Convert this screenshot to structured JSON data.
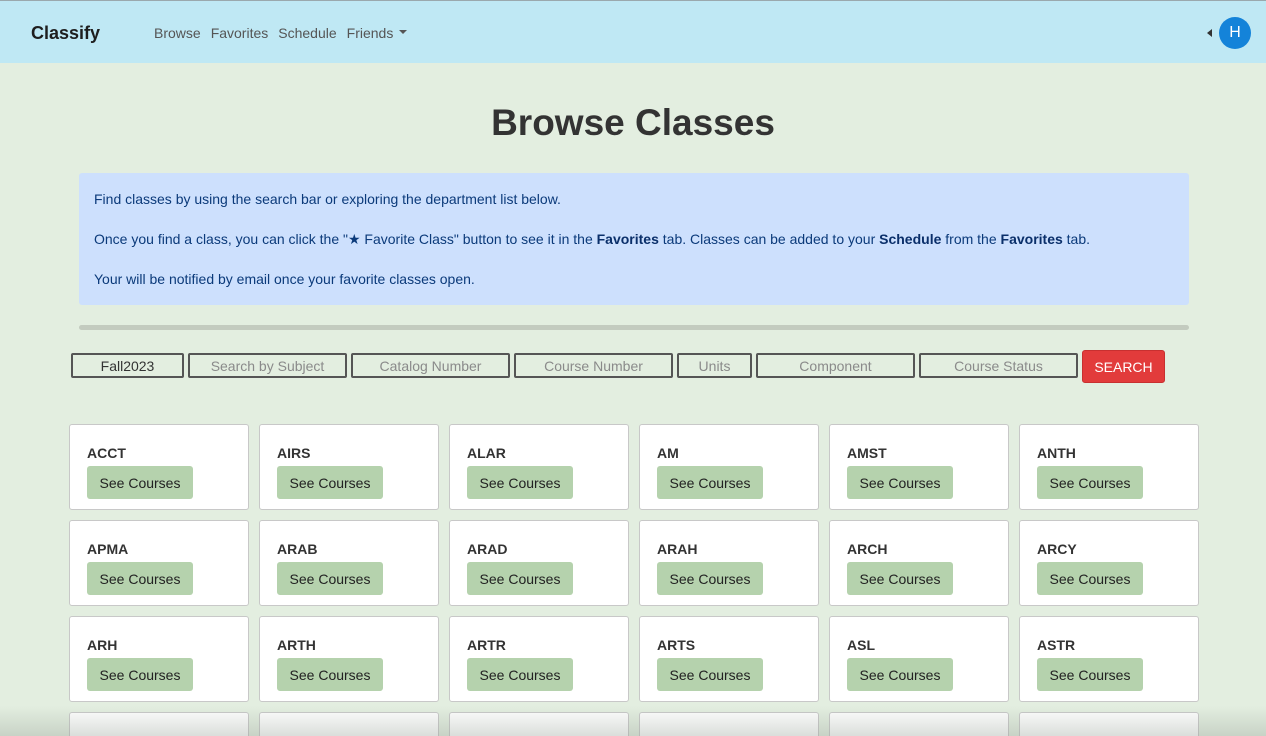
{
  "navbar": {
    "brand": "Classify",
    "links": [
      "Browse",
      "Favorites",
      "Schedule",
      "Friends"
    ],
    "avatar_initial": "H"
  },
  "page_title": "Browse Classes",
  "info": {
    "line1": "Find classes by using the search bar or exploring the department list below.",
    "line2_a": "Once you find a class, you can click the \"★ Favorite Class\" button to see it in the ",
    "line2_b": "Favorites",
    "line2_c": " tab. Classes can be added to your ",
    "line2_d": "Schedule",
    "line2_e": " from the ",
    "line2_f": "Favorites",
    "line2_g": " tab.",
    "line3": "Your will be notified by email once your favorite classes open."
  },
  "progress": 0,
  "filters": {
    "term_value": "Fall2023",
    "subject_placeholder": "Search by Subject",
    "catalog_placeholder": "Catalog Number",
    "course_placeholder": "Course Number",
    "units_placeholder": "Units",
    "component_placeholder": "Component",
    "status_placeholder": "Course Status",
    "search_label": "SEARCH"
  },
  "see_courses_label": "See Courses",
  "departments": [
    "ACCT",
    "AIRS",
    "ALAR",
    "AM",
    "AMST",
    "ANTH",
    "APMA",
    "ARAB",
    "ARAD",
    "ARAH",
    "ARCH",
    "ARCY",
    "ARH",
    "ARTH",
    "ARTR",
    "ARTS",
    "ASL",
    "ASTR"
  ],
  "colors": {
    "navbar_bg": "#bfe8f4",
    "page_bg": "#e3eee0",
    "search_button": "#e23b3b",
    "see_courses_button": "#b5d2ad",
    "info_bg": "#cde0fd",
    "avatar_bg": "#1483d9"
  }
}
